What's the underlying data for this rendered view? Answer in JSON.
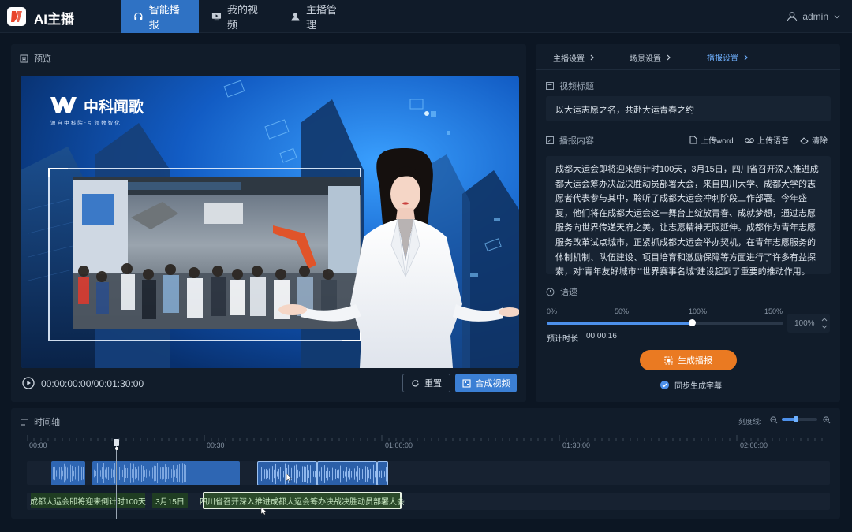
{
  "app": {
    "title": "AI主播",
    "logo": "app-logo"
  },
  "nav": {
    "tabs": [
      {
        "label": "智能播报",
        "icon": "headset-icon",
        "active": true
      },
      {
        "label": "我的视频",
        "icon": "monitor-play-icon",
        "active": false
      },
      {
        "label": "主播管理",
        "icon": "person-icon",
        "active": false
      }
    ],
    "user": "admin"
  },
  "preview": {
    "title": "预览",
    "brand_name": "中科闻歌",
    "brand_slogan": "源 自 中 科 院  ·  引 领 数 智 化",
    "time": "00:00:00:00/00:01:30:00",
    "reset_label": "重置",
    "compose_label": "合成视频"
  },
  "settings": {
    "tabs": [
      "主播设置",
      "场景设置",
      "播报设置"
    ],
    "active_tab": 2,
    "title_label": "视频标题",
    "title_value": "以大运志愿之名，共赴大运青春之约",
    "content_label": "播报内容",
    "tools": {
      "upload_word": "上传word",
      "upload_voice": "上传语音",
      "clear": "清除"
    },
    "content_text": "成都大运会即将迎来倒计时100天，3月15日，四川省召开深入推进成都大运会筹办决战决胜动员部署大会，来自四川大学、成都大学的志愿者代表参与其中，聆听了成都大运会冲刺阶段工作部署。今年盛夏，他们将在成都大运会这一舞台上绽放青春、成就梦想，通过志愿服务向世界传递天府之美，让志愿精神无限延伸。成都作为青年志愿服务改革试点城市，正紧抓成都大运会举办契机，在青年志愿服务的体制机制、队伍建设、项目培育和激励保障等方面进行了许多有益探索，对“青年友好城市”“世界赛事名城”建设起到了重要的推动作用。",
    "speed_label": "语速",
    "speed_ticks": [
      "0%",
      "50%",
      "100%",
      "150%"
    ],
    "speed_value": 100,
    "speed_display": "100%",
    "duration_label": "预计时长",
    "duration_value": "00:00:16",
    "generate_label": "生成播报",
    "subtitle_option": "同步生成字幕",
    "subtitle_checked": true
  },
  "timeline": {
    "title": "时间轴",
    "scale_label": "刻度线:",
    "ruler": [
      "00:00",
      "00:30",
      "01:00:00",
      "01:30:00",
      "02:00:00"
    ],
    "subtitles": [
      "成都大运会即将迎来倒计时100天",
      "3月15日",
      "四川省召开深入推进成都大运会筹办决战决胜动员部署大会"
    ]
  },
  "colors": {
    "accent": "#2f72c4",
    "orange": "#ea7a22",
    "subtitle_green": "#1f3d22"
  }
}
